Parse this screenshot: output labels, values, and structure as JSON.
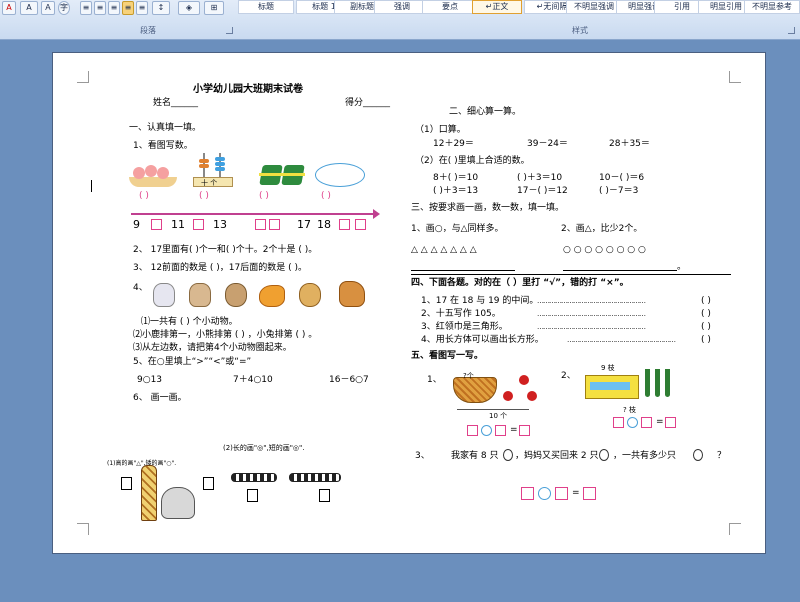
{
  "ribbon": {
    "paragraph_label": "段落",
    "styles_label": "样式",
    "font_color_letter": "A",
    "highlight_letter": "A",
    "styles": [
      "标题",
      "标题 1",
      "副标题",
      "强调",
      "要点",
      "↵正文",
      "↵无间隔",
      "不明显强调",
      "明显强调",
      "引用",
      "明显引用",
      "不明显参考"
    ]
  },
  "doc": {
    "title": "小学幼儿园大班期末试卷",
    "name_label": "姓名______",
    "score_label": "得分______",
    "left": {
      "s1": "一、认真填一填。",
      "q1": "1、看图写数。",
      "abacus_label": "十  个",
      "paren": "(          )",
      "numbers": [
        "9",
        "11",
        "13",
        "17",
        "18"
      ],
      "q2": "2、 17里面有(    )个一和(    )个十。2个十是 (    )。",
      "q3": "3、 12前面的数是 (    )，17后面的数是 (    )。",
      "q4": "4、",
      "q4a": "⑴一共有 (    ) 个小动物。",
      "q4b": "⑵小鹿排第一，小熊排第 (    ) ，小兔排第 (    ) 。",
      "q4c": "⑶从左边数，请把第4个小动物圈起来。",
      "q5": "5、在○里填上“>”“<”或“=”",
      "cmp": [
        "9○13",
        "7＋4○10",
        "16－6○7"
      ],
      "q6": "6、 画一画。",
      "draw1": "(1)高的画\"△\",矮的画\"○\".",
      "draw2": "(2)长的画\"◎\",短的画\"◎\"."
    },
    "right": {
      "s2": "二、细心算一算。",
      "oral": "（1）口算。",
      "oral_items": [
        "12＋29＝",
        "39－24＝",
        "28＋35＝"
      ],
      "fill": "（2）在( )里填上合适的数。",
      "fill_row1": [
        "8＋(   )＝10",
        "(   )＋3＝10",
        "10－(   )＝6"
      ],
      "fill_row2": [
        "(   )＋3＝13",
        "17－(   )＝12",
        "(   )－7＝3"
      ],
      "s3": "三、按要求画一画，数一数，填一填。",
      "draw_a": "1、画○，与△同样多。",
      "draw_b": "2、画△，比少2个。",
      "triangles": "△  △  △  △  △  △  △",
      "circles": "○  ○  ○  ○  ○  ○  ○  ○",
      "period": "。",
      "s4": "四、下面各题。对的在（ ）里打 “√”，错的打 “×”。",
      "judge": [
        "1、17 在 18 与 19 的中间。",
        "2、十五写作 105。",
        "3、红领巾是三角形。",
        "4、用长方体可以画出长方形。"
      ],
      "judge_dots": "………………………………………………",
      "judge_paren": "(    )",
      "s5": "五、看图写一写。",
      "w1": "1、",
      "w2": "2、",
      "basket_q": "?个",
      "bottom_label": "10 个",
      "pencil_label": "9 枝",
      "pencil_q": "? 枝",
      "w3": "3、",
      "w3_text": "我家有 8 只",
      "w3_text2": "，妈妈又买回来 2 只",
      "w3_text3": "，一共有多少只",
      "w3_q": "？",
      "equals": "="
    }
  },
  "colors": {
    "pink": "#e0408a",
    "blue": "#4aa0d8",
    "page": "#ffffff",
    "bg": "#6b8fbd"
  }
}
